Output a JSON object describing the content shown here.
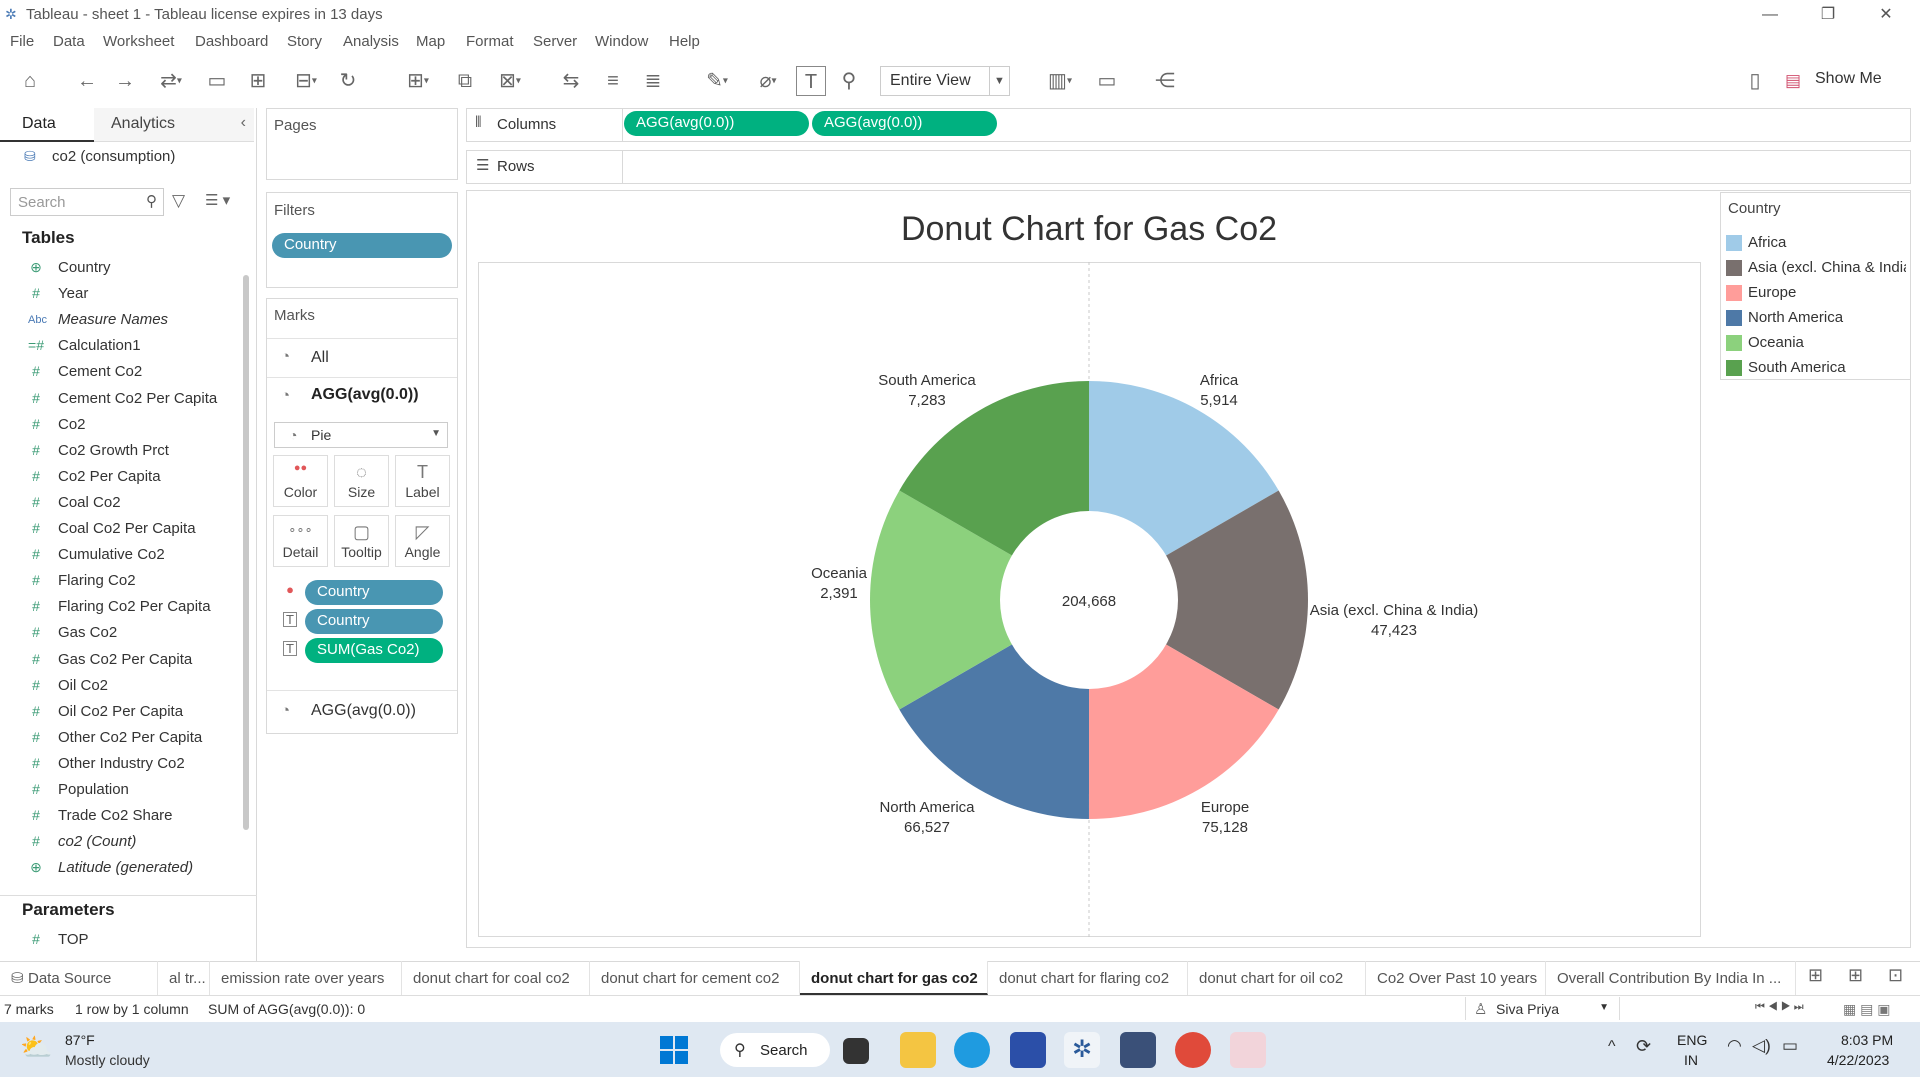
{
  "window": {
    "title": "Tableau - sheet 1 - Tableau license expires in 13 days"
  },
  "menu": [
    "File",
    "Data",
    "Worksheet",
    "Dashboard",
    "Story",
    "Analysis",
    "Map",
    "Format",
    "Server",
    "Window",
    "Help"
  ],
  "toolbar": {
    "view_select": "Entire View",
    "show_me": "Show Me"
  },
  "datapane": {
    "tab_data": "Data",
    "tab_analytics": "Analytics",
    "datasource": "co2 (consumption)",
    "search_placeholder": "Search",
    "tables_header": "Tables",
    "fields": [
      {
        "name": "Country",
        "icon": "globe-icon",
        "glyph": "⊕"
      },
      {
        "name": "Year",
        "icon": "measure-icon",
        "glyph": "#"
      },
      {
        "name": "Measure Names",
        "icon": "string-icon",
        "glyph": "Abc",
        "italic": true
      },
      {
        "name": "Calculation1",
        "icon": "calc-measure-icon",
        "glyph": "=#"
      },
      {
        "name": "Cement Co2",
        "icon": "measure-icon",
        "glyph": "#"
      },
      {
        "name": "Cement Co2 Per Capita",
        "icon": "measure-icon",
        "glyph": "#"
      },
      {
        "name": "Co2",
        "icon": "measure-icon",
        "glyph": "#"
      },
      {
        "name": "Co2 Growth Prct",
        "icon": "measure-icon",
        "glyph": "#"
      },
      {
        "name": "Co2 Per Capita",
        "icon": "measure-icon",
        "glyph": "#"
      },
      {
        "name": "Coal Co2",
        "icon": "measure-icon",
        "glyph": "#"
      },
      {
        "name": "Coal Co2 Per Capita",
        "icon": "measure-icon",
        "glyph": "#"
      },
      {
        "name": "Cumulative Co2",
        "icon": "measure-icon",
        "glyph": "#"
      },
      {
        "name": "Flaring Co2",
        "icon": "measure-icon",
        "glyph": "#"
      },
      {
        "name": "Flaring Co2 Per Capita",
        "icon": "measure-icon",
        "glyph": "#"
      },
      {
        "name": "Gas Co2",
        "icon": "measure-icon",
        "glyph": "#"
      },
      {
        "name": "Gas Co2 Per Capita",
        "icon": "measure-icon",
        "glyph": "#"
      },
      {
        "name": "Oil Co2",
        "icon": "measure-icon",
        "glyph": "#"
      },
      {
        "name": "Oil Co2 Per Capita",
        "icon": "measure-icon",
        "glyph": "#"
      },
      {
        "name": "Other Co2 Per Capita",
        "icon": "measure-icon",
        "glyph": "#"
      },
      {
        "name": "Other Industry Co2",
        "icon": "measure-icon",
        "glyph": "#"
      },
      {
        "name": "Population",
        "icon": "measure-icon",
        "glyph": "#"
      },
      {
        "name": "Trade Co2 Share",
        "icon": "measure-icon",
        "glyph": "#"
      },
      {
        "name": "co2 (Count)",
        "icon": "measure-icon",
        "glyph": "#",
        "italic": true
      },
      {
        "name": "Latitude (generated)",
        "icon": "globe-icon",
        "glyph": "⊕",
        "italic": true
      }
    ],
    "parameters_header": "Parameters",
    "parameters": [
      {
        "name": "TOP",
        "icon": "measure-icon",
        "glyph": "#"
      }
    ]
  },
  "cards": {
    "pages": "Pages",
    "filters": "Filters",
    "filter_pill": "Country",
    "marks": "Marks",
    "marks_all": "All",
    "marks_layer1": "AGG(avg(0.0))",
    "mark_type": "Pie",
    "buttons": [
      {
        "label": "Color",
        "icon": "color-icon",
        "glyph": "●●"
      },
      {
        "label": "Size",
        "icon": "size-icon",
        "glyph": "◌"
      },
      {
        "label": "Label",
        "icon": "label-icon",
        "glyph": "T"
      },
      {
        "label": "Detail",
        "icon": "detail-icon",
        "glyph": "∘∘∘"
      },
      {
        "label": "Tooltip",
        "icon": "tooltip-icon",
        "glyph": "▢"
      },
      {
        "label": "Angle",
        "icon": "angle-icon",
        "glyph": "◸"
      }
    ],
    "mark_pills": [
      {
        "label": "Country",
        "kind": "blue",
        "icon": "color-icon",
        "glyph": "●"
      },
      {
        "label": "Country",
        "kind": "blue",
        "icon": "label-icon",
        "glyph": "T"
      },
      {
        "label": "SUM(Gas Co2)",
        "kind": "green",
        "icon": "label-icon",
        "glyph": "T"
      }
    ],
    "marks_layer2": "AGG(avg(0.0))"
  },
  "shelves": {
    "columns_label": "Columns",
    "rows_label": "Rows",
    "column_pills": [
      "AGG(avg(0.0))",
      "AGG(avg(0.0))"
    ]
  },
  "colors": {
    "Africa": "#a0cbe8",
    "Asia (excl. China & India)": "#79706e",
    "Europe": "#ff9d9a",
    "North America": "#4e79a7",
    "Oceania": "#8cd17d",
    "South America": "#59a14f"
  },
  "chart_data": {
    "type": "pie",
    "title": "Donut Chart for Gas Co2",
    "center_label": "204,668",
    "legend_title": "Country",
    "legend_placement": "right",
    "categories": [
      "Africa",
      "Asia (excl. China & India)",
      "Europe",
      "North America",
      "Oceania",
      "South America"
    ],
    "values": [
      5914,
      47423,
      75128,
      66527,
      2391,
      7283
    ],
    "value_labels": [
      "5,914",
      "47,423",
      "75,128",
      "66,527",
      "2,391",
      "7,283"
    ],
    "slice_fraction_each": 0.16667
  },
  "sheet_tabs": [
    "Data Source",
    "al tr...",
    "emission rate over years",
    "donut chart for coal co2",
    "donut chart for cement co2",
    "donut chart for gas co2",
    "donut chart for flaring co2",
    "donut chart for oil co2",
    "Co2 Over Past 10 years",
    "Overall Contribution By India In ..."
  ],
  "active_tab": "donut chart for gas co2",
  "status": {
    "marks": "7 marks",
    "rows": "1 row by 1 column",
    "sum": "SUM of AGG(avg(0.0)): 0",
    "user": "Siva Priya"
  },
  "taskbar": {
    "temp": "87°F",
    "weather": "Mostly cloudy",
    "search": "Search",
    "lang1": "ENG",
    "lang2": "IN",
    "time": "8:03 PM",
    "date": "4/22/2023"
  }
}
